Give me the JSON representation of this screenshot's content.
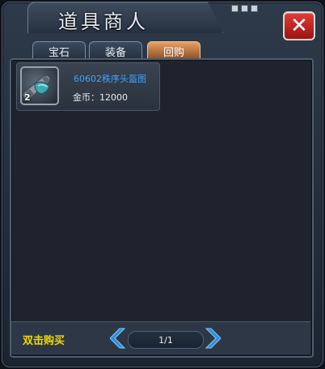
{
  "window": {
    "title": "道具商人",
    "close_label": "✕"
  },
  "tabs": [
    {
      "label": "宝石",
      "active": false
    },
    {
      "label": "装备",
      "active": false
    },
    {
      "label": "回购",
      "active": true
    }
  ],
  "items": [
    {
      "name": "60602秩序头盔图",
      "quantity": "2",
      "price_label": "金币：",
      "price": "12000",
      "icon": "helmet-blueprint-scroll-icon"
    }
  ],
  "footer": {
    "hint": "双击购买",
    "page": "1/1"
  },
  "colors": {
    "accent_tab": "#c9773e",
    "item_name": "#3ea3ff",
    "hint": "#f0d800",
    "close": "#c42420"
  }
}
